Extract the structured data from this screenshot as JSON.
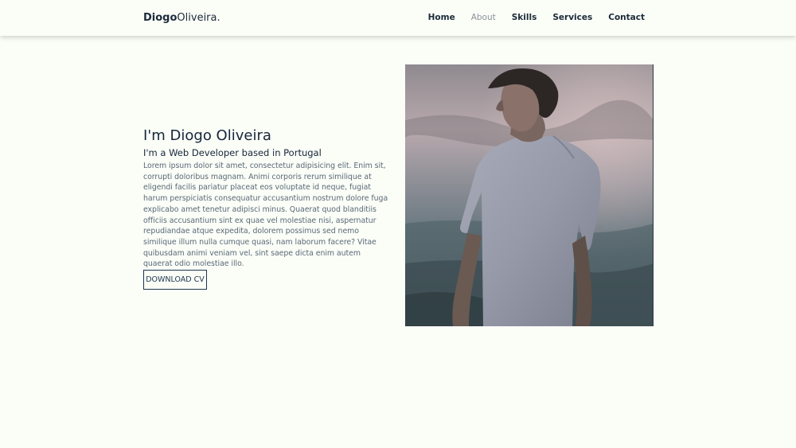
{
  "header": {
    "logo_first": "Diogo",
    "logo_last": "Oliveira."
  },
  "nav": {
    "items": [
      {
        "label": "Home",
        "active": false
      },
      {
        "label": "About",
        "active": true
      },
      {
        "label": "Skills",
        "active": false
      },
      {
        "label": "Services",
        "active": false
      },
      {
        "label": "Contact",
        "active": false
      }
    ]
  },
  "about": {
    "title": "I'm Diogo Oliveira",
    "subtitle": "I'm a Web Developer based in Portugal",
    "body": "Lorem ipsum dolor sit amet, consectetur adipisicing elit. Enim sit, corrupti doloribus magnam. Animi corporis rerum similique at eligendi facilis pariatur placeat eos voluptate id neque, fugiat harum perspiciatis consequatur accusantium nostrum dolore fuga explicabo amet tenetur adipisci minus. Quaerat quod blanditiis officiis accusantium sint ex quae vel molestiae nisi, aspernatur repudiandae atque expedita, dolorem possimus sed nemo similique illum nulla cumque quasi, nam laborum facere? Vitae quibusdam animi veniam vel, sint saepe dicta enim autem quaerat odio molestiae illo.",
    "cv_button": "DOWNLOAD CV"
  },
  "colors": {
    "background": "#fbfdf7",
    "text_dark": "#15263a",
    "text_muted": "#5a6a78",
    "nav_active": "#8a9299",
    "button_border": "#1c3550"
  }
}
